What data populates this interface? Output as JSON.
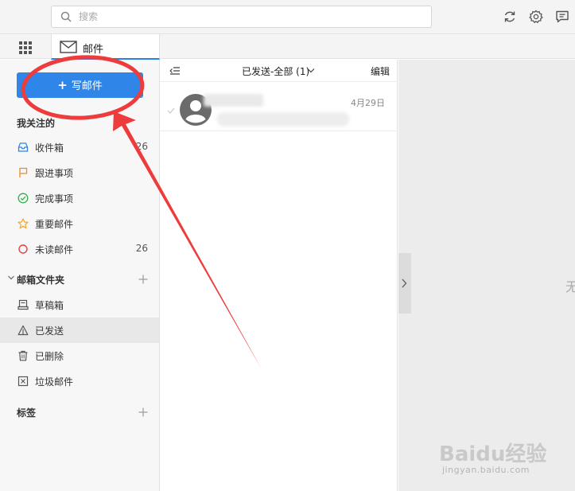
{
  "search": {
    "placeholder": "搜索"
  },
  "top_icons": [
    "refresh-icon",
    "settings-icon",
    "chat-icon"
  ],
  "tab": {
    "label": "邮件"
  },
  "sidebar": {
    "compose_label": "写邮件",
    "favorites_title": "我关注的",
    "favorites": [
      {
        "label": "收件箱",
        "count": "26",
        "icon": "inbox-icon"
      },
      {
        "label": "跟进事项",
        "count": "",
        "icon": "flag-icon"
      },
      {
        "label": "完成事项",
        "count": "",
        "icon": "check-circle-icon"
      },
      {
        "label": "重要邮件",
        "count": "",
        "icon": "star-icon"
      },
      {
        "label": "未读邮件",
        "count": "26",
        "icon": "unread-circle-icon"
      }
    ],
    "folders_title": "邮箱文件夹",
    "folders": [
      {
        "label": "草稿箱",
        "icon": "draft-icon"
      },
      {
        "label": "已发送",
        "icon": "sent-icon",
        "active": true
      },
      {
        "label": "已删除",
        "icon": "trash-icon"
      },
      {
        "label": "垃圾邮件",
        "icon": "spam-icon"
      }
    ],
    "tags_title": "标签"
  },
  "list": {
    "folder_label": "已发送-全部 (1)",
    "edit_label": "编辑",
    "items": [
      {
        "date": "4月29日"
      }
    ]
  },
  "reading_pane": {
    "empty_text": "无"
  },
  "watermark": {
    "logo": "Baidu经验",
    "url": "jingyan.baidu.com"
  },
  "colors": {
    "accent": "#2f86e8",
    "annotation": "#ee3b3b"
  }
}
